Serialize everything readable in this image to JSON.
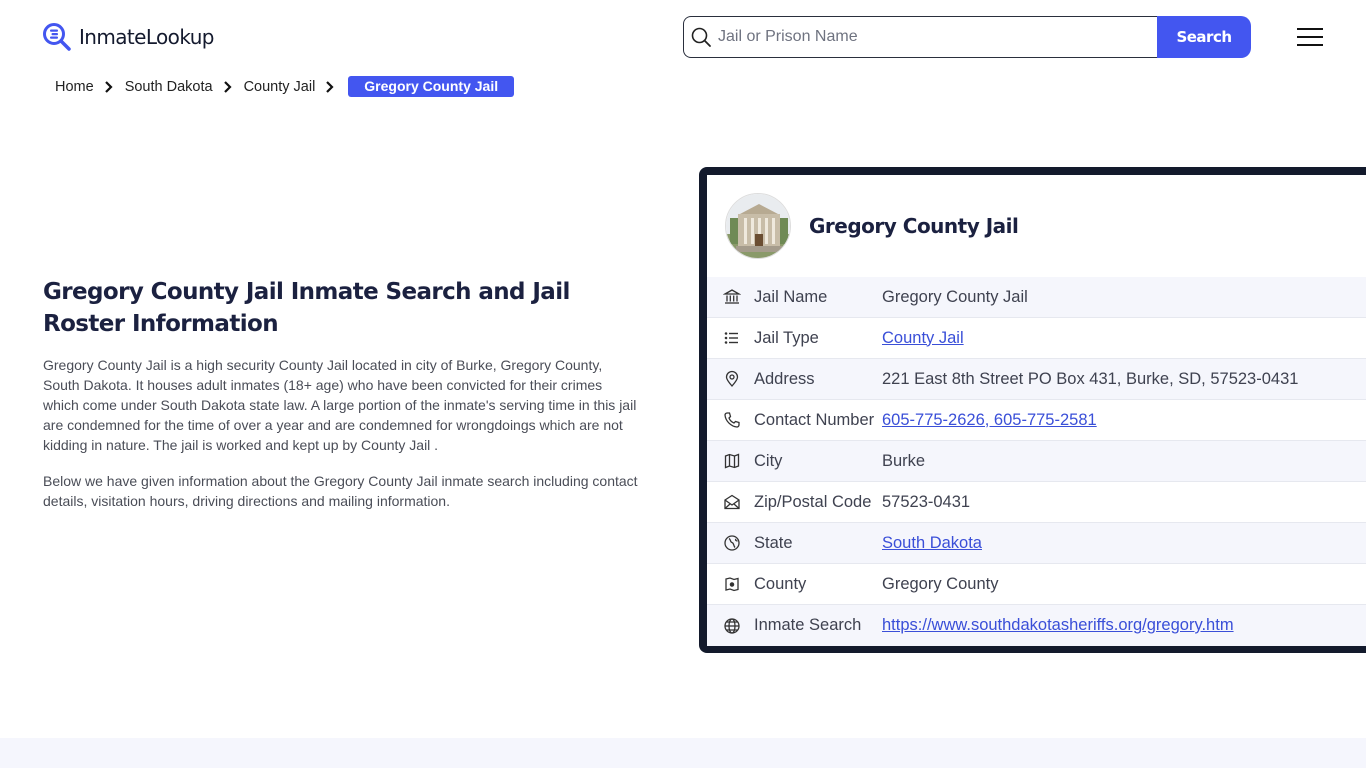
{
  "header": {
    "logo_text": "InmateLookup",
    "search_placeholder": "Jail or Prison Name",
    "search_value": "",
    "search_button": "Search",
    "menu_icon": "hamburger-menu-icon"
  },
  "breadcrumb": {
    "items": [
      "Home",
      "South Dakota",
      "County Jail"
    ],
    "current": "Gregory County Jail"
  },
  "main": {
    "title": "Gregory County Jail Inmate Search and Jail Roster Information",
    "paragraphs": [
      "Gregory County Jail is a high security County Jail located in city of Burke, Gregory County, South Dakota. It houses adult inmates (18+ age) who have been convicted for their crimes which come under South Dakota state law. A large portion of the inmate's serving time in this jail are condemned for the time of over a year and are condemned for wrongdoings which are not kidding in nature. The jail is worked and kept up by County Jail .",
      "Below we have given information about the Gregory County Jail inmate search including contact details, visitation hours, driving directions and mailing information."
    ]
  },
  "card": {
    "title": "Gregory County Jail",
    "rows": [
      {
        "icon": "building-columns-icon",
        "label": "Jail Name",
        "value": "Gregory County Jail",
        "link": false
      },
      {
        "icon": "list-icon",
        "label": "Jail Type",
        "value": "County Jail",
        "link": true
      },
      {
        "icon": "map-pin-icon",
        "label": "Address",
        "value": "221 East 8th Street PO Box 431, Burke, SD, 57523-0431",
        "link": false
      },
      {
        "icon": "phone-icon",
        "label": "Contact Number",
        "value": "605-775-2626, 605-775-2581",
        "link": true
      },
      {
        "icon": "map-icon",
        "label": "City",
        "value": "Burke",
        "link": false
      },
      {
        "icon": "mail-open-icon",
        "label": "Zip/Postal Code",
        "value": "57523-0431",
        "link": false
      },
      {
        "icon": "globe-location-icon",
        "label": "State",
        "value": "South Dakota",
        "link": true
      },
      {
        "icon": "county-map-icon",
        "label": "County",
        "value": "Gregory County",
        "link": false
      },
      {
        "icon": "globe-icon",
        "label": "Inmate Search",
        "value": "https://www.southdakotasheriffs.org/gregory.htm",
        "link": true
      }
    ]
  },
  "colors": {
    "accent": "#4356f0",
    "link": "#3a4fd8",
    "card_border": "#131a2c",
    "row_alt_bg": "#f5f6fc",
    "heading": "#1b2140"
  }
}
